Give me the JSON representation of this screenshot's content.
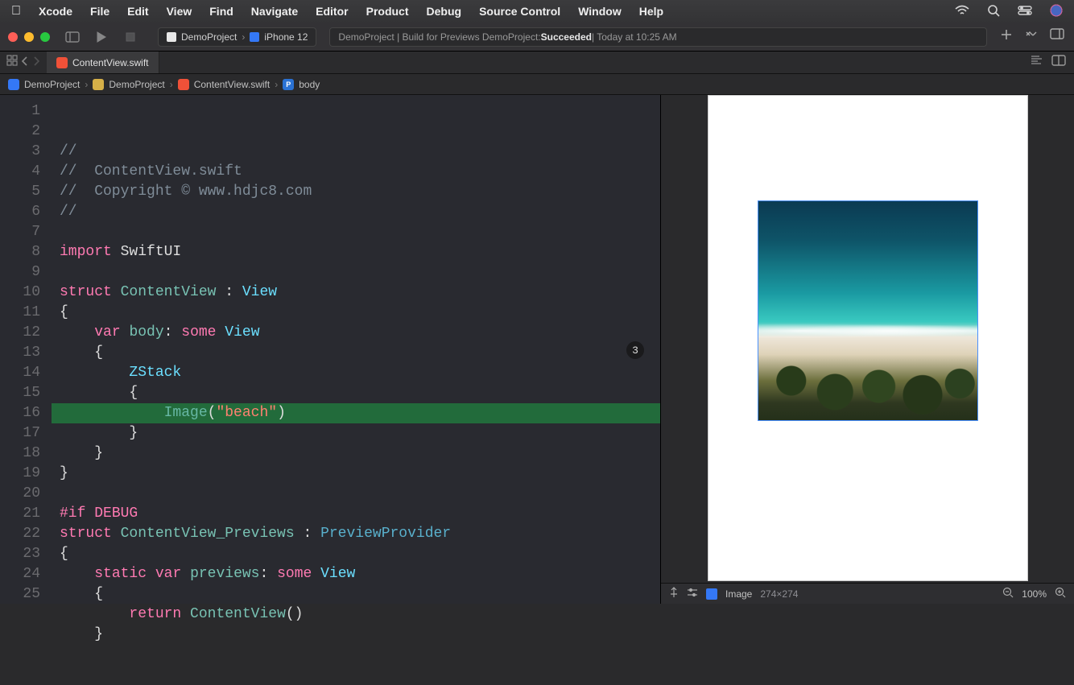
{
  "menubar": {
    "app": "Xcode",
    "items": [
      "File",
      "Edit",
      "View",
      "Find",
      "Navigate",
      "Editor",
      "Product",
      "Debug",
      "Source Control",
      "Window",
      "Help"
    ]
  },
  "toolbar": {
    "scheme_project": "DemoProject",
    "scheme_device": "iPhone 12",
    "status_prefix": "DemoProject | Build for Previews DemoProject: ",
    "status_result": "Succeeded",
    "status_time": " | Today at 10:25 AM"
  },
  "tabs": {
    "file": "ContentView.swift"
  },
  "jumpbar": {
    "project": "DemoProject",
    "folder": "DemoProject",
    "file": "ContentView.swift",
    "symbol_prefix": "P",
    "symbol": "body"
  },
  "code": {
    "highlight_line": 14,
    "badge": "3",
    "lines": [
      {
        "n": 1,
        "seg": [
          {
            "c": "c-comm",
            "t": "//"
          }
        ]
      },
      {
        "n": 2,
        "seg": [
          {
            "c": "c-comm",
            "t": "//  ContentView.swift"
          }
        ]
      },
      {
        "n": 3,
        "seg": [
          {
            "c": "c-comm",
            "t": "//  Copyright © www.hdjc8.com"
          }
        ]
      },
      {
        "n": 4,
        "seg": [
          {
            "c": "c-comm",
            "t": "//"
          }
        ]
      },
      {
        "n": 5,
        "seg": []
      },
      {
        "n": 6,
        "seg": [
          {
            "c": "c-kw",
            "t": "import"
          },
          {
            "c": "c-txt",
            "t": " SwiftUI"
          }
        ]
      },
      {
        "n": 7,
        "seg": []
      },
      {
        "n": 8,
        "seg": [
          {
            "c": "c-kw",
            "t": "struct"
          },
          {
            "c": "c-txt",
            "t": " "
          },
          {
            "c": "c-prop",
            "t": "ContentView"
          },
          {
            "c": "c-txt",
            "t": " : "
          },
          {
            "c": "c-type",
            "t": "View"
          }
        ]
      },
      {
        "n": 9,
        "seg": [
          {
            "c": "c-txt",
            "t": "{"
          }
        ]
      },
      {
        "n": 10,
        "seg": [
          {
            "c": "c-txt",
            "t": "    "
          },
          {
            "c": "c-kw",
            "t": "var"
          },
          {
            "c": "c-txt",
            "t": " "
          },
          {
            "c": "c-prop",
            "t": "body"
          },
          {
            "c": "c-txt",
            "t": ": "
          },
          {
            "c": "c-kw",
            "t": "some"
          },
          {
            "c": "c-txt",
            "t": " "
          },
          {
            "c": "c-type",
            "t": "View"
          }
        ]
      },
      {
        "n": 11,
        "seg": [
          {
            "c": "c-txt",
            "t": "    {"
          }
        ]
      },
      {
        "n": 12,
        "seg": [
          {
            "c": "c-txt",
            "t": "        "
          },
          {
            "c": "c-type",
            "t": "ZStack"
          }
        ]
      },
      {
        "n": 13,
        "seg": [
          {
            "c": "c-txt",
            "t": "        {"
          }
        ]
      },
      {
        "n": 14,
        "seg": [
          {
            "c": "c-txt",
            "t": "            "
          },
          {
            "c": "c-call",
            "t": "Image"
          },
          {
            "c": "c-txt",
            "t": "("
          },
          {
            "c": "c-str",
            "t": "\"beach\""
          },
          {
            "c": "c-txt",
            "t": ")"
          }
        ]
      },
      {
        "n": 15,
        "seg": [
          {
            "c": "c-txt",
            "t": "        }"
          }
        ]
      },
      {
        "n": 16,
        "seg": [
          {
            "c": "c-txt",
            "t": "    }"
          }
        ]
      },
      {
        "n": 17,
        "seg": [
          {
            "c": "c-txt",
            "t": "}"
          }
        ]
      },
      {
        "n": 18,
        "seg": []
      },
      {
        "n": 19,
        "seg": [
          {
            "c": "c-kw",
            "t": "#if"
          },
          {
            "c": "c-txt",
            "t": " "
          },
          {
            "c": "c-kw",
            "t": "DEBUG"
          }
        ]
      },
      {
        "n": 20,
        "seg": [
          {
            "c": "c-kw",
            "t": "struct"
          },
          {
            "c": "c-txt",
            "t": " "
          },
          {
            "c": "c-prop",
            "t": "ContentView_Previews"
          },
          {
            "c": "c-txt",
            "t": " : "
          },
          {
            "c": "c-ptype",
            "t": "PreviewProvider"
          }
        ]
      },
      {
        "n": 21,
        "seg": [
          {
            "c": "c-txt",
            "t": "{"
          }
        ]
      },
      {
        "n": 22,
        "seg": [
          {
            "c": "c-txt",
            "t": "    "
          },
          {
            "c": "c-kw",
            "t": "static"
          },
          {
            "c": "c-txt",
            "t": " "
          },
          {
            "c": "c-kw",
            "t": "var"
          },
          {
            "c": "c-txt",
            "t": " "
          },
          {
            "c": "c-prop",
            "t": "previews"
          },
          {
            "c": "c-txt",
            "t": ": "
          },
          {
            "c": "c-kw",
            "t": "some"
          },
          {
            "c": "c-txt",
            "t": " "
          },
          {
            "c": "c-type",
            "t": "View"
          }
        ]
      },
      {
        "n": 23,
        "seg": [
          {
            "c": "c-txt",
            "t": "    {"
          }
        ]
      },
      {
        "n": 24,
        "seg": [
          {
            "c": "c-txt",
            "t": "        "
          },
          {
            "c": "c-kw",
            "t": "return"
          },
          {
            "c": "c-txt",
            "t": " "
          },
          {
            "c": "c-prop",
            "t": "ContentView"
          },
          {
            "c": "c-txt",
            "t": "()"
          }
        ]
      },
      {
        "n": 25,
        "seg": [
          {
            "c": "c-txt",
            "t": "    }"
          }
        ]
      }
    ]
  },
  "preview": {
    "label": "Image",
    "size": "274×274",
    "zoom": "100%"
  }
}
